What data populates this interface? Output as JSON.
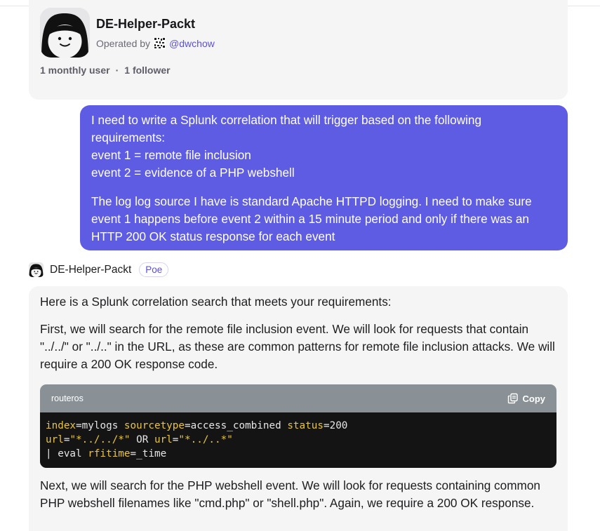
{
  "bot": {
    "name": "DE-Helper-Packt",
    "operated_by_label": "Operated by",
    "operator_handle": "@dwchow",
    "monthly_users": "1 monthly user",
    "separator": "·",
    "followers": "1 follower"
  },
  "user_message": {
    "paragraphs": [
      "I need to write a Splunk correlation that will trigger based on the following requirements:",
      "event 1 = remote file inclusion",
      "event 2 = evidence of a PHP webshell",
      "The log log source I have is standard Apache HTTPD logging. I need to make sure event 1 happens before event 2 within a 15 minute period and only if there was an HTTP 200 OK status response for each event"
    ]
  },
  "response": {
    "bot_name": "DE-Helper-Packt",
    "badge": "Poe",
    "intro": "Here is a Splunk correlation search that meets your requirements:",
    "para1": "First, we will search for the remote file inclusion event. We will look for requests that contain \"../../\" or \"../..\" in the URL, as these are common patterns for remote file inclusion attacks. We will require a 200 OK response code.",
    "code": {
      "language": "routeros",
      "copy_label": "Copy",
      "line1": {
        "k1": "index",
        "v1": "=mylogs ",
        "k2": "sourcetype",
        "v2": "=access_combined ",
        "k3": "status",
        "v3": "=200"
      },
      "line2": {
        "k1": "url",
        "eq1": "=",
        "s1": "\"*../../*\"",
        "op": " OR ",
        "k2": "url",
        "eq2": "=",
        "s2": "\"*../..*\""
      },
      "line3": {
        "pipe": "| eval ",
        "k1": "rfitime",
        "rest": "=_time"
      }
    },
    "para2": "Next, we will search for the PHP webshell event. We will look for requests containing common PHP webshell filenames like \"cmd.php\" or \"shell.php\". Again, we require a 200 OK response."
  },
  "icons": {
    "bot_avatar": "smiley-face-avatar",
    "operator_icon": "qr-pattern-icon",
    "copy": "copy-icon"
  },
  "colors": {
    "user_bubble": "#5d5ce3",
    "accent": "#5b50d8",
    "code_header": "#8a9196",
    "code_bg": "#141414",
    "keyword": "#e8c53d"
  }
}
